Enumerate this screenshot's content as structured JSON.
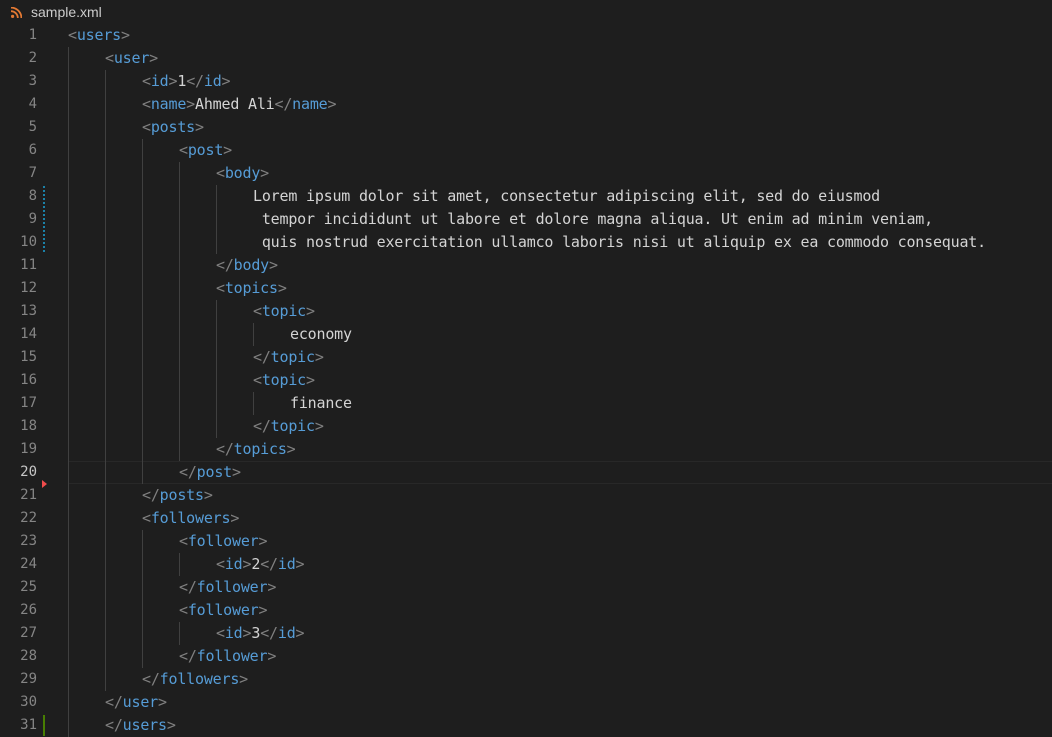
{
  "tab": {
    "title": "sample.xml",
    "icon": "rss-feed-icon"
  },
  "editor": {
    "active_line": 20,
    "lines": [
      {
        "num": "1",
        "indent": 0,
        "tokens": [
          [
            "p",
            "<"
          ],
          [
            "t",
            "users"
          ],
          [
            "p",
            ">"
          ]
        ]
      },
      {
        "num": "2",
        "indent": 1,
        "tokens": [
          [
            "p",
            "<"
          ],
          [
            "t",
            "user"
          ],
          [
            "p",
            ">"
          ]
        ]
      },
      {
        "num": "3",
        "indent": 2,
        "tokens": [
          [
            "p",
            "<"
          ],
          [
            "t",
            "id"
          ],
          [
            "p",
            ">"
          ],
          [
            "x",
            "1"
          ],
          [
            "p",
            "</"
          ],
          [
            "t",
            "id"
          ],
          [
            "p",
            ">"
          ]
        ]
      },
      {
        "num": "4",
        "indent": 2,
        "tokens": [
          [
            "p",
            "<"
          ],
          [
            "t",
            "name"
          ],
          [
            "p",
            ">"
          ],
          [
            "x",
            "Ahmed Ali"
          ],
          [
            "p",
            "</"
          ],
          [
            "t",
            "name"
          ],
          [
            "p",
            ">"
          ]
        ]
      },
      {
        "num": "5",
        "indent": 2,
        "tokens": [
          [
            "p",
            "<"
          ],
          [
            "t",
            "posts"
          ],
          [
            "p",
            ">"
          ]
        ]
      },
      {
        "num": "6",
        "indent": 3,
        "tokens": [
          [
            "p",
            "<"
          ],
          [
            "t",
            "post"
          ],
          [
            "p",
            ">"
          ]
        ]
      },
      {
        "num": "7",
        "indent": 4,
        "tokens": [
          [
            "p",
            "<"
          ],
          [
            "t",
            "body"
          ],
          [
            "p",
            ">"
          ]
        ]
      },
      {
        "num": "8",
        "indent": 5,
        "tokens": [
          [
            "x",
            "Lorem ipsum dolor sit amet, consectetur adipiscing elit, sed do eiusmod"
          ]
        ]
      },
      {
        "num": "9",
        "indent": 5,
        "tokens": [
          [
            "x",
            " tempor incididunt ut labore et dolore magna aliqua. Ut enim ad minim veniam,"
          ]
        ]
      },
      {
        "num": "10",
        "indent": 5,
        "tokens": [
          [
            "x",
            " quis nostrud exercitation ullamco laboris nisi ut aliquip ex ea commodo consequat."
          ]
        ]
      },
      {
        "num": "11",
        "indent": 4,
        "tokens": [
          [
            "p",
            "</"
          ],
          [
            "t",
            "body"
          ],
          [
            "p",
            ">"
          ]
        ]
      },
      {
        "num": "12",
        "indent": 4,
        "tokens": [
          [
            "p",
            "<"
          ],
          [
            "t",
            "topics"
          ],
          [
            "p",
            ">"
          ]
        ]
      },
      {
        "num": "13",
        "indent": 5,
        "tokens": [
          [
            "p",
            "<"
          ],
          [
            "t",
            "topic"
          ],
          [
            "p",
            ">"
          ]
        ]
      },
      {
        "num": "14",
        "indent": 6,
        "tokens": [
          [
            "x",
            "economy"
          ]
        ]
      },
      {
        "num": "15",
        "indent": 5,
        "tokens": [
          [
            "p",
            "</"
          ],
          [
            "t",
            "topic"
          ],
          [
            "p",
            ">"
          ]
        ]
      },
      {
        "num": "16",
        "indent": 5,
        "tokens": [
          [
            "p",
            "<"
          ],
          [
            "t",
            "topic"
          ],
          [
            "p",
            ">"
          ]
        ]
      },
      {
        "num": "17",
        "indent": 6,
        "tokens": [
          [
            "x",
            "finance"
          ]
        ]
      },
      {
        "num": "18",
        "indent": 5,
        "tokens": [
          [
            "p",
            "</"
          ],
          [
            "t",
            "topic"
          ],
          [
            "p",
            ">"
          ]
        ]
      },
      {
        "num": "19",
        "indent": 4,
        "tokens": [
          [
            "p",
            "</"
          ],
          [
            "t",
            "topics"
          ],
          [
            "p",
            ">"
          ]
        ]
      },
      {
        "num": "20",
        "indent": 3,
        "tokens": [
          [
            "p",
            "</"
          ],
          [
            "t",
            "post"
          ],
          [
            "p",
            ">"
          ]
        ]
      },
      {
        "num": "21",
        "indent": 2,
        "tokens": [
          [
            "p",
            "</"
          ],
          [
            "t",
            "posts"
          ],
          [
            "p",
            ">"
          ]
        ]
      },
      {
        "num": "22",
        "indent": 2,
        "tokens": [
          [
            "p",
            "<"
          ],
          [
            "t",
            "followers"
          ],
          [
            "p",
            ">"
          ]
        ]
      },
      {
        "num": "23",
        "indent": 3,
        "tokens": [
          [
            "p",
            "<"
          ],
          [
            "t",
            "follower"
          ],
          [
            "p",
            ">"
          ]
        ]
      },
      {
        "num": "24",
        "indent": 4,
        "tokens": [
          [
            "p",
            "<"
          ],
          [
            "t",
            "id"
          ],
          [
            "p",
            ">"
          ],
          [
            "x",
            "2"
          ],
          [
            "p",
            "</"
          ],
          [
            "t",
            "id"
          ],
          [
            "p",
            ">"
          ]
        ]
      },
      {
        "num": "25",
        "indent": 3,
        "tokens": [
          [
            "p",
            "</"
          ],
          [
            "t",
            "follower"
          ],
          [
            "p",
            ">"
          ]
        ]
      },
      {
        "num": "26",
        "indent": 3,
        "tokens": [
          [
            "p",
            "<"
          ],
          [
            "t",
            "follower"
          ],
          [
            "p",
            ">"
          ]
        ]
      },
      {
        "num": "27",
        "indent": 4,
        "tokens": [
          [
            "p",
            "<"
          ],
          [
            "t",
            "id"
          ],
          [
            "p",
            ">"
          ],
          [
            "x",
            "3"
          ],
          [
            "p",
            "</"
          ],
          [
            "t",
            "id"
          ],
          [
            "p",
            ">"
          ]
        ]
      },
      {
        "num": "28",
        "indent": 3,
        "tokens": [
          [
            "p",
            "</"
          ],
          [
            "t",
            "follower"
          ],
          [
            "p",
            ">"
          ]
        ]
      },
      {
        "num": "29",
        "indent": 2,
        "tokens": [
          [
            "p",
            "</"
          ],
          [
            "t",
            "followers"
          ],
          [
            "p",
            ">"
          ]
        ]
      },
      {
        "num": "30",
        "indent": 1,
        "tokens": [
          [
            "p",
            "</"
          ],
          [
            "t",
            "user"
          ],
          [
            "p",
            ">"
          ]
        ]
      },
      {
        "num": "31",
        "indent": 1,
        "tokens": [
          [
            "p",
            "</"
          ],
          [
            "t",
            "users"
          ],
          [
            "p",
            ">"
          ]
        ]
      }
    ]
  },
  "colors": {
    "background": "#1e1e1e",
    "tag": "#569cd6",
    "punctuation": "#808080",
    "text": "#d4d4d4",
    "line_number": "#858585",
    "active_line_number": "#c6c6c6",
    "modified_gutter": "#1b81a8",
    "added_gutter": "#487e02",
    "deleted_gutter": "#f14c4c",
    "rss_icon": "#e37933"
  },
  "gutter_markers": [
    {
      "kind": "modified",
      "from": 8,
      "to": 10
    },
    {
      "kind": "deleted",
      "after": 20
    },
    {
      "kind": "added",
      "from": 31,
      "to": 31
    }
  ]
}
